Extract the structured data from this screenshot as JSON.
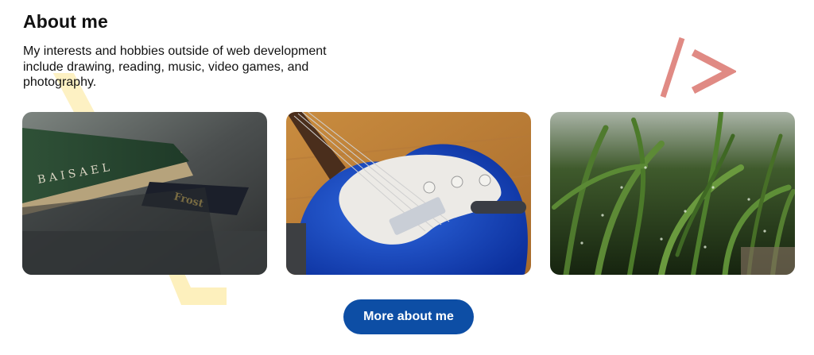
{
  "about": {
    "title": "About me",
    "description": "My interests and hobbies outside of web development include drawing, reading, music, video games, and photography."
  },
  "photos": [
    {
      "subject": "book"
    },
    {
      "subject": "electric-guitar"
    },
    {
      "subject": "grass-with-dew"
    }
  ],
  "button": {
    "label": "More about me"
  },
  "colors": {
    "accent": "#0d4ea5",
    "deco_yellow": "#fdf0bd",
    "deco_red": "#e08a84"
  }
}
